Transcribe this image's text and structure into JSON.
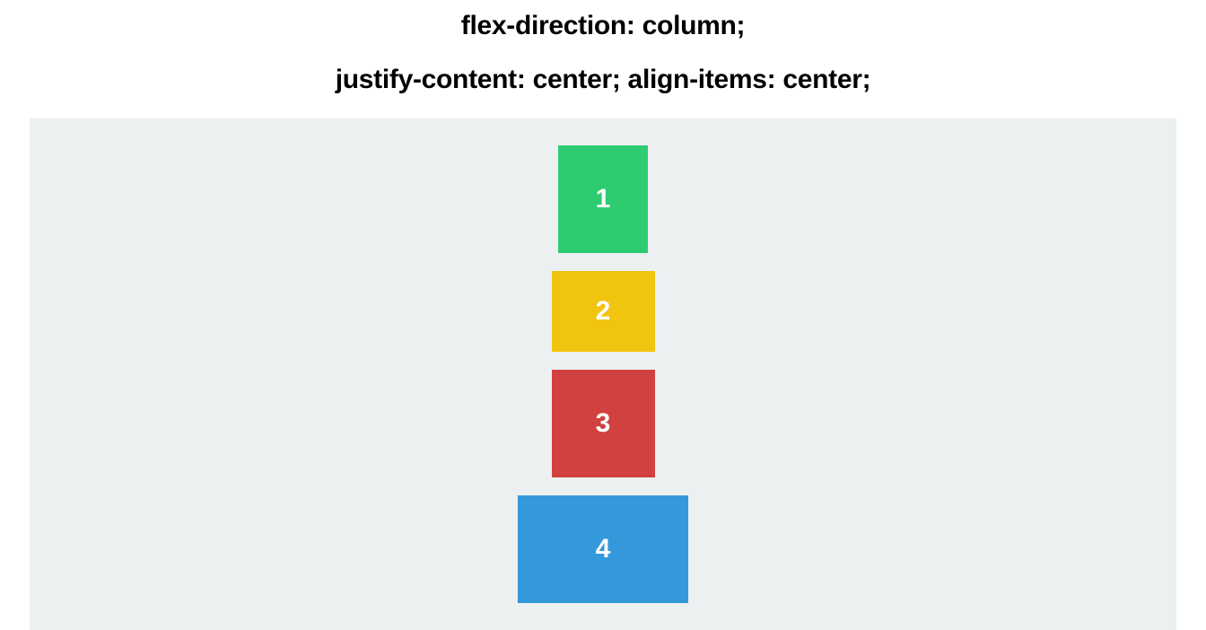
{
  "headings": {
    "line1": "flex-direction: column;",
    "line2": "justify-content: center; align-items: center;"
  },
  "boxes": [
    {
      "label": "1",
      "color": "#2ecc71"
    },
    {
      "label": "2",
      "color": "#f1c40f"
    },
    {
      "label": "3",
      "color": "#d0413f"
    },
    {
      "label": "4",
      "color": "#3498db"
    }
  ],
  "container": {
    "background": "#ecf0f1"
  }
}
